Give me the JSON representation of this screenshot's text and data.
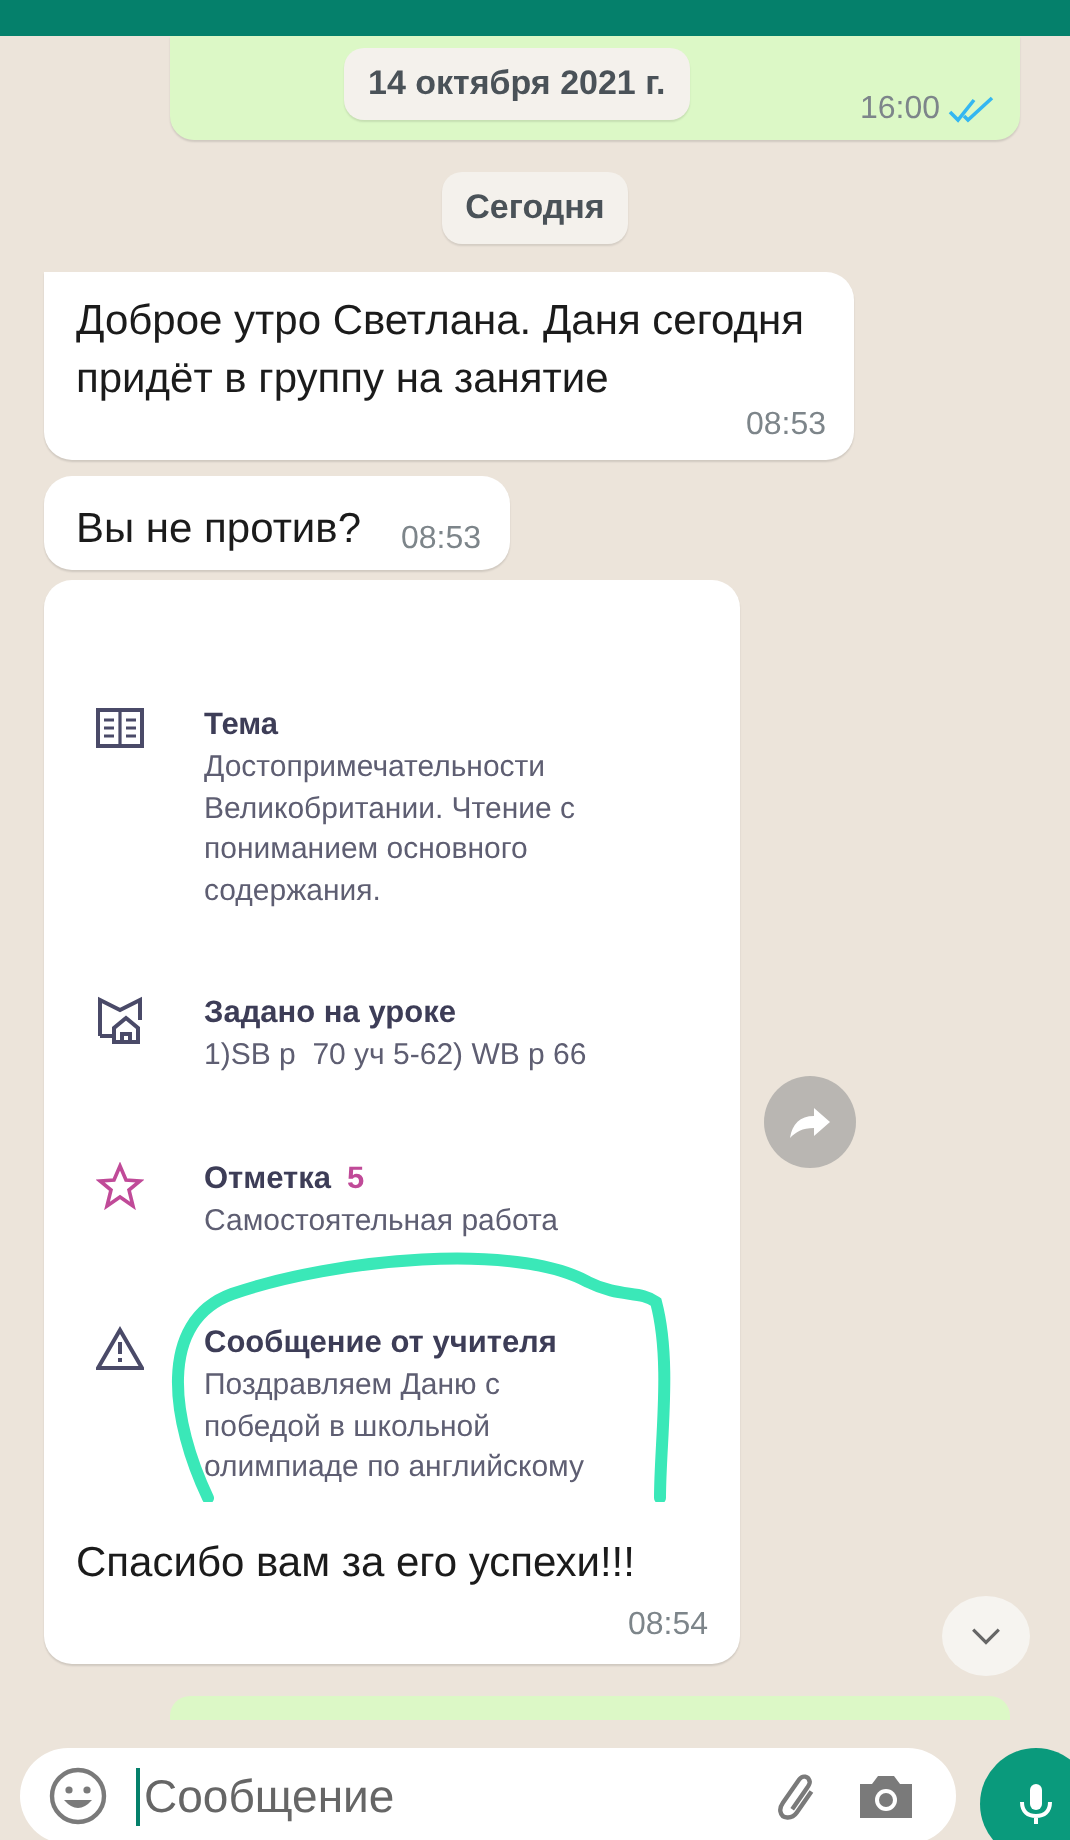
{
  "previous_message": {
    "time": "16:00",
    "read": true
  },
  "date_chips": [
    "14 октября 2021 г.",
    "Сегодня"
  ],
  "messages": [
    {
      "kind": "text",
      "text": "Доброе утро Светлана. Даня сегодня придёт в группу на занятие",
      "time": "08:53",
      "tail": true
    },
    {
      "kind": "text",
      "text": "Вы не против?",
      "time": "08:53",
      "tail": false
    },
    {
      "kind": "card",
      "items": [
        {
          "kind": "book",
          "title": "Тема",
          "text": "Достопримечательности Великобритании. Чтение с пониманием основного содержания.",
          "highlighted": false
        },
        {
          "kind": "home",
          "title": "Задано на уроке",
          "text": "1)SB p  70 уч 5-62) WB p 66",
          "highlighted": false
        },
        {
          "kind": "star",
          "title": "Отметка",
          "grade": "5",
          "text": "Самостоятельная работа",
          "highlighted": false
        },
        {
          "kind": "warning",
          "title": "Сообщение от учителя",
          "text": "Поздравляем Даню с победой в школьной олимпиаде по английскому",
          "highlighted": true
        }
      ],
      "caption": "Спасибо вам за его успехи!!!",
      "time": "08:54",
      "tail": false
    }
  ],
  "composer": {
    "placeholder": "Сообщение"
  }
}
